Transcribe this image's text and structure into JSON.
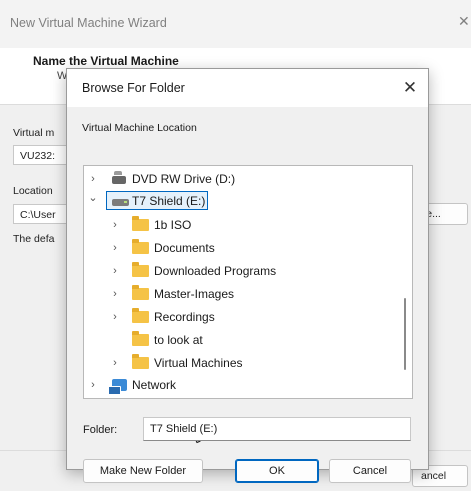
{
  "wizard": {
    "title": "New Virtual Machine Wizard",
    "close_glyph": "✕",
    "heading": "Name the Virtual Machine",
    "subheading_partial": "W",
    "vm_name_label_partial": "Virtual m",
    "vm_name_value_partial": "VU232:",
    "location_label_partial": "Location",
    "location_value_partial": "C:\\User",
    "default_text_partial": "The defa",
    "browse_button_partial": "se...",
    "cancel_button_partial": "ancel"
  },
  "dialog": {
    "title": "Browse For Folder",
    "close_glyph": "✕",
    "description": "Virtual Machine Location",
    "tree": [
      {
        "label": "DVD RW Drive (D:)",
        "icon": "dvd-drive-icon",
        "chevron": "›",
        "level": 0,
        "selected": false
      },
      {
        "label": "T7 Shield (E:)",
        "icon": "drive-icon",
        "chevron": "⌄",
        "level": 0,
        "selected": true
      },
      {
        "label": "1b ISO",
        "icon": "folder-icon",
        "chevron": "›",
        "level": 1,
        "selected": false
      },
      {
        "label": "Documents",
        "icon": "folder-icon",
        "chevron": "›",
        "level": 1,
        "selected": false
      },
      {
        "label": "Downloaded Programs",
        "icon": "folder-icon",
        "chevron": "›",
        "level": 1,
        "selected": false
      },
      {
        "label": "Master-Images",
        "icon": "folder-icon",
        "chevron": "›",
        "level": 1,
        "selected": false
      },
      {
        "label": "Recordings",
        "icon": "folder-icon",
        "chevron": "›",
        "level": 1,
        "selected": false
      },
      {
        "label": "to look at",
        "icon": "folder-icon",
        "chevron": "",
        "level": 1,
        "selected": false
      },
      {
        "label": "Virtual Machines",
        "icon": "folder-icon",
        "chevron": "›",
        "level": 1,
        "selected": false
      },
      {
        "label": "Network",
        "icon": "network-icon",
        "chevron": "›",
        "level": 0,
        "selected": false
      }
    ],
    "folder_label": "Folder:",
    "folder_value": "T7 Shield (E:)",
    "buttons": {
      "make_new_folder": "Make New Folder",
      "ok": "OK",
      "cancel": "Cancel"
    }
  },
  "colors": {
    "accent": "#0067c0",
    "folder": "#f5c346",
    "selection_fill": "#e5f1fb"
  }
}
